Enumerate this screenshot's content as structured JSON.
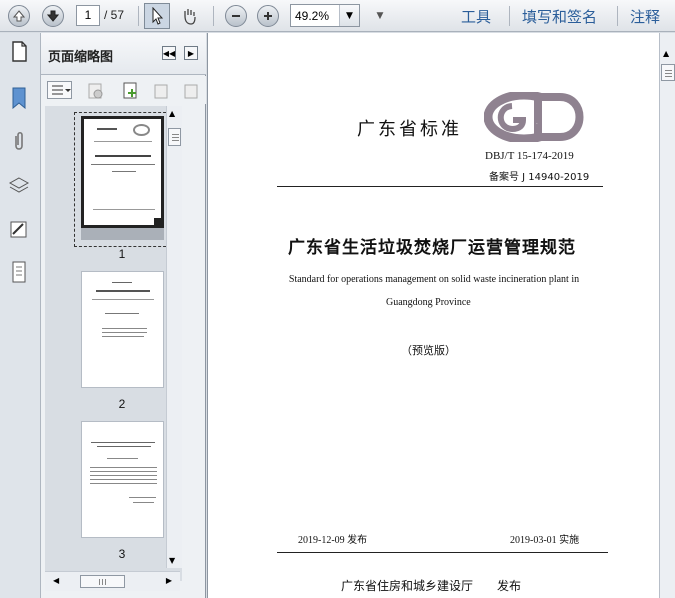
{
  "toolbar": {
    "current_page": "1",
    "total_pages": "/ 57",
    "zoom": "49.2%",
    "menus": [
      "工具",
      "填写和签名",
      "注释"
    ]
  },
  "panel": {
    "title": "页面缩略图",
    "thumbnails": [
      {
        "label": "1"
      },
      {
        "label": "2"
      },
      {
        "label": "3"
      }
    ]
  },
  "document": {
    "header_org": "广东省标准",
    "logo_text": "GD",
    "std_no": "DBJ/T 15-174-2019",
    "record_no": "备案号 J 14940-2019",
    "title_cn": "广东省生活垃圾焚烧厂运营管理规范",
    "title_en_line1": "Standard for operations management on solid waste incineration plant in",
    "title_en_line2": "Guangdong Province",
    "preview": "（预览版）",
    "issue_date": "2019-12-09 发布",
    "effective_date": "2019-03-01 实施",
    "publisher": "广东省住房和城乡建设厅",
    "publish_word": "发布"
  },
  "colors": {
    "toolbar_bg": "#e7ebef",
    "menu_link": "#2b5e9a",
    "logo": "#8b7f8d"
  },
  "icons": [
    "up-arrow-icon",
    "down-arrow-icon",
    "select-cursor-icon",
    "hand-icon",
    "zoom-out-icon",
    "zoom-in-icon",
    "page-thumbnails-icon",
    "bookmark-icon",
    "attachment-icon",
    "layers-icon",
    "signature-icon",
    "document-icon"
  ]
}
